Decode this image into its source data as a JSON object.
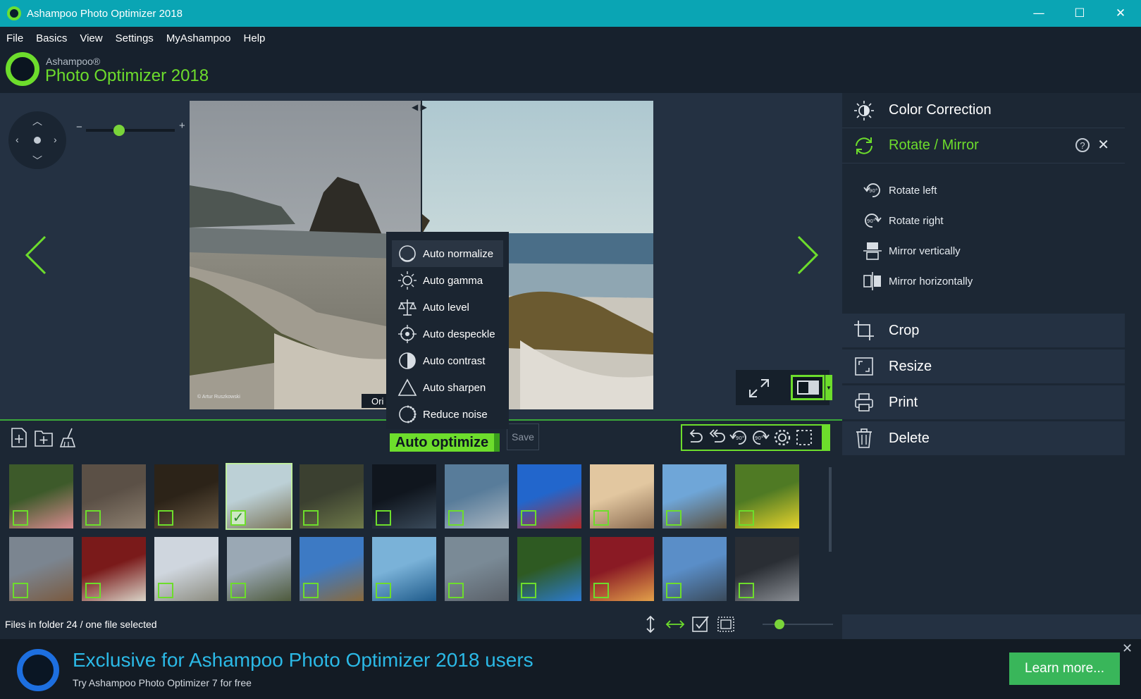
{
  "window": {
    "title": "Ashampoo Photo Optimizer 2018",
    "controls": [
      "—",
      "☐",
      "✕"
    ]
  },
  "menu": [
    "File",
    "Basics",
    "View",
    "Settings",
    "MyAshampoo",
    "Help"
  ],
  "logo": {
    "brand": "Ashampoo®",
    "product": "Photo Optimizer 2018"
  },
  "preview": {
    "caption": "© Artur Ruszkowski",
    "original_badge": "Ori",
    "zoom_minus": "−",
    "zoom_plus": "+",
    "zoom_level": 0.35
  },
  "auto_menu": {
    "items": [
      {
        "label": "Auto normalize",
        "icon": "normalize-icon",
        "active": true
      },
      {
        "label": "Auto gamma",
        "icon": "gamma-icon",
        "active": false
      },
      {
        "label": "Auto level",
        "icon": "level-icon",
        "active": false
      },
      {
        "label": "Auto despeckle",
        "icon": "despeckle-icon",
        "active": false
      },
      {
        "label": "Auto contrast",
        "icon": "contrast-icon",
        "active": false
      },
      {
        "label": "Auto sharpen",
        "icon": "sharpen-icon",
        "active": false
      },
      {
        "label": "Reduce noise",
        "icon": "noise-icon",
        "active": false
      }
    ]
  },
  "toolbar": {
    "auto_optimize_label": "Auto optimize",
    "save_label": "Save"
  },
  "right_panel": {
    "color_correction": "Color Correction",
    "rotate_mirror": "Rotate / Mirror",
    "help": "?",
    "close": "✕",
    "sub_items": [
      {
        "label": "Rotate left",
        "icon": "rotate-left-icon"
      },
      {
        "label": "Rotate right",
        "icon": "rotate-right-icon"
      },
      {
        "label": "Mirror vertically",
        "icon": "mirror-vertical-icon"
      },
      {
        "label": "Mirror horizontally",
        "icon": "mirror-horizontal-icon"
      }
    ],
    "tools": [
      {
        "label": "Crop",
        "icon": "crop-icon"
      },
      {
        "label": "Resize",
        "icon": "resize-icon"
      },
      {
        "label": "Print",
        "icon": "print-icon"
      },
      {
        "label": "Delete",
        "icon": "delete-icon"
      }
    ]
  },
  "thumbnails": {
    "row1": [
      {
        "name": "spoonbill",
        "c1": "#3d5a2a",
        "c2": "#d98a8f",
        "checked": false
      },
      {
        "name": "monkey",
        "c1": "#5b5046",
        "c2": "#8d8070",
        "checked": false
      },
      {
        "name": "barrels",
        "c1": "#2c2318",
        "c2": "#6a5a44",
        "checked": false
      },
      {
        "name": "haystack-rock",
        "c1": "#bcd0d6",
        "c2": "#7a7458",
        "checked": true
      },
      {
        "name": "hoopoe",
        "c1": "#3b4030",
        "c2": "#6f7a4a",
        "checked": false
      },
      {
        "name": "city-night",
        "c1": "#10161e",
        "c2": "#3a4a5a",
        "checked": false
      },
      {
        "name": "egret",
        "c1": "#587c9a",
        "c2": "#aab6c0",
        "checked": false
      },
      {
        "name": "woman-hat",
        "c1": "#2266cc",
        "c2": "#b22a2a",
        "checked": false
      },
      {
        "name": "desert",
        "c1": "#e2c7a0",
        "c2": "#8a6b50",
        "checked": false
      },
      {
        "name": "eiffel",
        "c1": "#6fa6d8",
        "c2": "#5a4e3c",
        "checked": false
      },
      {
        "name": "yellow-flowers",
        "c1": "#4f7a24",
        "c2": "#e8d42c",
        "checked": false
      }
    ],
    "row2": [
      {
        "name": "canal",
        "c1": "#7b8590",
        "c2": "#7a5a40",
        "checked": false
      },
      {
        "name": "tailor",
        "c1": "#7a1a1a",
        "c2": "#d9d4c8",
        "checked": false
      },
      {
        "name": "lighthouse",
        "c1": "#cfd6de",
        "c2": "#8c8c80",
        "checked": false
      },
      {
        "name": "coast",
        "c1": "#9aa8b4",
        "c2": "#4e5a3c",
        "checked": false
      },
      {
        "name": "island",
        "c1": "#3d7ac4",
        "c2": "#8a6a3c",
        "checked": false
      },
      {
        "name": "blue-car",
        "c1": "#7ab2d8",
        "c2": "#1e5a8a",
        "checked": false
      },
      {
        "name": "truck",
        "c1": "#7a8a96",
        "c2": "#5a6068",
        "checked": false
      },
      {
        "name": "macaw",
        "c1": "#2e5a22",
        "c2": "#2c7ad0",
        "checked": false
      },
      {
        "name": "cat",
        "c1": "#8a1a24",
        "c2": "#e2a04a",
        "checked": false
      },
      {
        "name": "golden-gate",
        "c1": "#5a8ec8",
        "c2": "#3a4a5a",
        "checked": false
      },
      {
        "name": "skyline",
        "c1": "#2a2e34",
        "c2": "#8a8e94",
        "checked": false
      }
    ]
  },
  "status": {
    "text": "Files in folder 24 / one file selected",
    "thumb_size": 0.2
  },
  "promo": {
    "title": "Exclusive for Ashampoo Photo Optimizer 2018 users",
    "subtitle": "Try Ashampoo Photo Optimizer 7 for free",
    "button": "Learn more...",
    "close": "✕"
  },
  "colors": {
    "accent_green": "#6ddd2c",
    "title_teal": "#0aa5b4",
    "promo_blue": "#2bb9e6",
    "learn_green": "#39b65a"
  }
}
